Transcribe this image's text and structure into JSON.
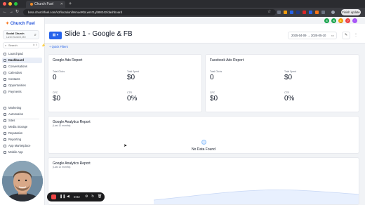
{
  "browser": {
    "tab_title": "Church Fuel",
    "url": "beta.churchfuel.com/v2/location/lHmueRbLwm7Lyb88242/dashboard",
    "finish_label": "Finish update",
    "ext_colors": [
      "#6b7280",
      "#f59e0b",
      "#2563eb",
      "#1e3a8a",
      "#dc2626",
      "#2563eb",
      "#f97316",
      "#6b7280"
    ]
  },
  "sidebar": {
    "logo": "Church Fuel",
    "account": {
      "name": "Social Church",
      "sub": "Lorem Summit, MO"
    },
    "search": {
      "placeholder": "Search",
      "shortcut": "⌘ K"
    },
    "items": [
      {
        "label": "Launchpad",
        "active": false
      },
      {
        "label": "Dashboard",
        "active": true
      },
      {
        "label": "Conversations",
        "active": false
      },
      {
        "label": "Calendars",
        "active": false
      },
      {
        "label": "Contacts",
        "active": false
      },
      {
        "label": "Opportunities",
        "active": false
      },
      {
        "label": "Payments",
        "active": false
      },
      {
        "label": "Marketing",
        "active": false
      },
      {
        "label": "Automation",
        "active": false
      },
      {
        "label": "Sites",
        "active": false
      },
      {
        "label": "Media Storage",
        "active": false
      },
      {
        "label": "Reputation",
        "active": false
      },
      {
        "label": "Reporting",
        "active": false
      },
      {
        "label": "App Marketplace",
        "active": false
      },
      {
        "label": "Mobile App",
        "active": false
      }
    ]
  },
  "header": {
    "title": "Slide 1 - Google & FB",
    "date_from": "2025-04-09",
    "arrow": "→",
    "date_to": "2025-05-10",
    "quick_filters": "+ Quick Filters"
  },
  "google_ads": {
    "title": "Google Ads Report",
    "metrics": [
      {
        "label": "Total Clicks",
        "value": "0"
      },
      {
        "label": "Total Spent",
        "value": "$0"
      },
      {
        "label": "CPC",
        "value": "$0"
      },
      {
        "label": "CTR",
        "value": "0%"
      }
    ]
  },
  "facebook_ads": {
    "title": "Facebook Ads Report",
    "metrics": [
      {
        "label": "Total Clicks",
        "value": "0"
      },
      {
        "label": "Total Spent",
        "value": "$0"
      },
      {
        "label": "CPC",
        "value": "$0"
      },
      {
        "label": "CTR",
        "value": "0%"
      }
    ]
  },
  "analytics_1": {
    "title": "Google Analytics Report",
    "sub": "(Last 12 months)",
    "empty": "No Data Found"
  },
  "analytics_2": {
    "title": "Google Analytics Report",
    "sub": "(Last 12 months)"
  },
  "recorder": {
    "time": "0:02"
  }
}
